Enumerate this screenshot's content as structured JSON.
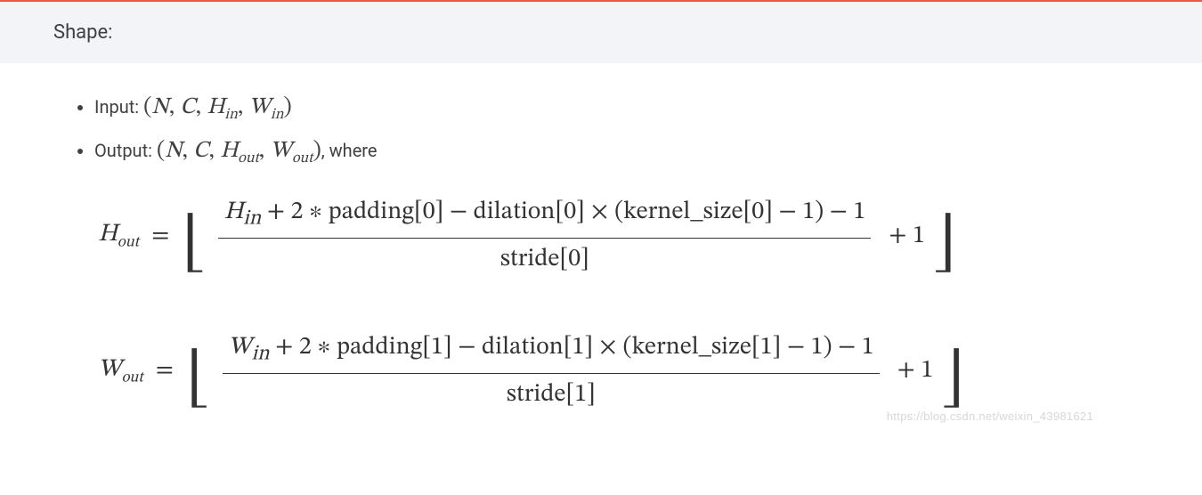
{
  "header": {
    "title": "Shape:"
  },
  "labels": {
    "input": "Input:",
    "output": "Output:",
    "where": ", where"
  },
  "tuple": {
    "input": "(N, C, H_in, W_in)",
    "output": "(N, C, H_out, W_out)"
  },
  "formula_h": {
    "lhs": "H_out",
    "numerator": "H_in + 2 ∗ padding[0] − dilation[0] × (kernel_size[0] − 1) − 1",
    "denominator": "stride[0]",
    "tail": "+ 1"
  },
  "formula_w": {
    "lhs": "W_out",
    "numerator": "W_in + 2 ∗ padding[1] − dilation[1] × (kernel_size[1] − 1) − 1",
    "denominator": "stride[1]",
    "tail": "+ 1"
  },
  "watermark": "https://blog.csdn.net/weixin_43981621"
}
